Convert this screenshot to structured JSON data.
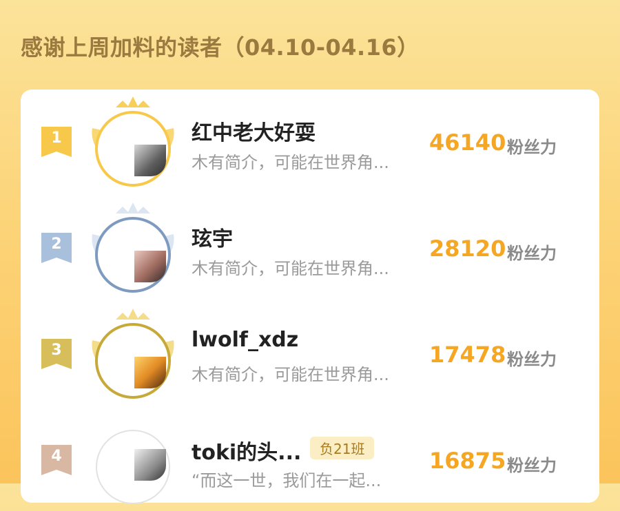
{
  "header": {
    "title": "感谢上周加料的读者（04.10-04.16）"
  },
  "leaderboard": {
    "unit_label": "粉丝力",
    "entries": [
      {
        "rank": "1",
        "name": "红中老大好耍",
        "bio": "木有简介，可能在世界角...",
        "tag": "",
        "score": "46140",
        "ring_color": "#f7c84a",
        "badge_color": "#f7c84a"
      },
      {
        "rank": "2",
        "name": "玹宇",
        "bio": "木有简介，可能在世界角...",
        "tag": "",
        "score": "28120",
        "ring_color": "#7e9bbf",
        "badge_color": "#a9c0dd"
      },
      {
        "rank": "3",
        "name": "lwolf_xdz",
        "bio": "木有简介，可能在世界角...",
        "tag": "",
        "score": "17478",
        "ring_color": "#c7a93a",
        "badge_color": "#d8be5a"
      },
      {
        "rank": "4",
        "name": "toki的头...",
        "bio": "“而这一世，我们在一起...",
        "tag": "负21班",
        "score": "16875",
        "ring_color": "#cfcfcf",
        "badge_color": "#d9b8a3"
      }
    ]
  }
}
